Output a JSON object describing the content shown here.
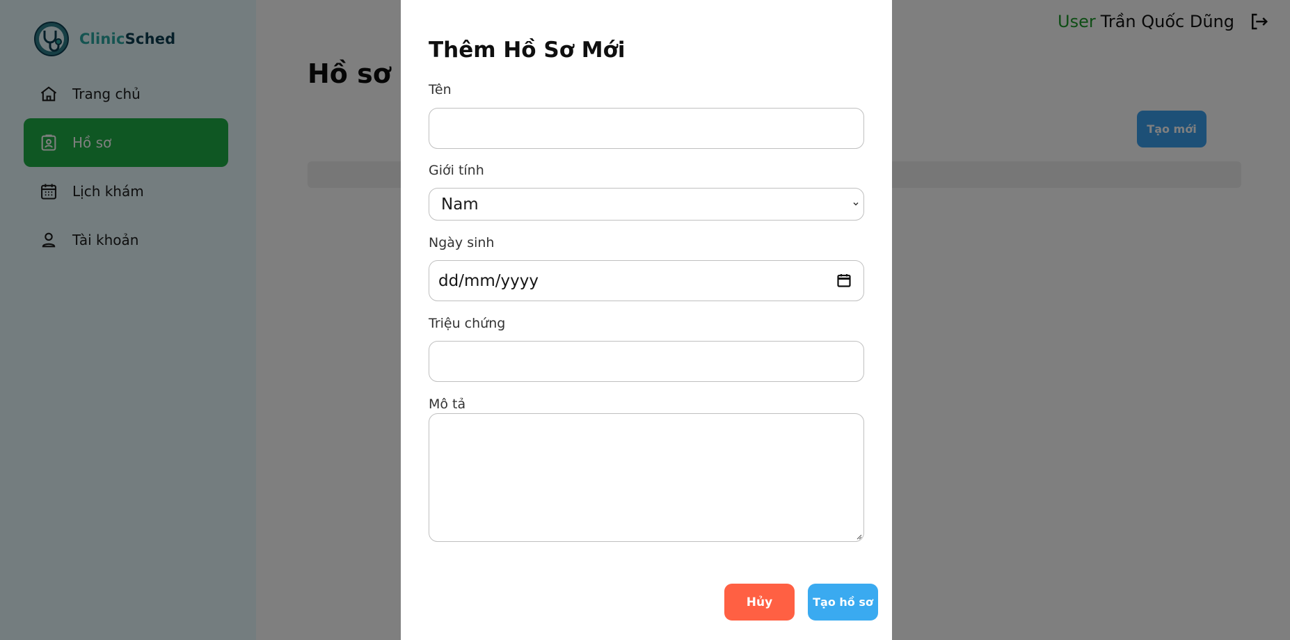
{
  "brand": {
    "name_part1": "Clinic",
    "name_part2": "Sched",
    "logo_icon": "stethoscope-logo-icon"
  },
  "sidebar": {
    "items": [
      {
        "label": "Trang chủ",
        "icon": "home-icon",
        "active": false
      },
      {
        "label": "Hồ sơ",
        "icon": "profile-badge-icon",
        "active": true
      },
      {
        "label": "Lịch khám",
        "icon": "calendar-icon",
        "active": false
      },
      {
        "label": "Tài khoản",
        "icon": "user-icon",
        "active": false
      }
    ]
  },
  "header": {
    "user_prefix": "User",
    "user_name": "Trần Quốc Dũng",
    "logout_icon": "logout-icon"
  },
  "main": {
    "title": "Hồ sơ",
    "create_button": "Tạo mới"
  },
  "modal": {
    "title": "Thêm Hồ Sơ Mới",
    "fields": {
      "name_label": "Tên",
      "name_value": "",
      "gender_label": "Giới tính",
      "gender_value": "Nam",
      "dob_label": "Ngày sinh",
      "dob_value": "dd/mm/yyyy",
      "symptoms_label": "Triệu chứng",
      "symptoms_value": "",
      "description_label": "Mô tả",
      "description_value": ""
    },
    "cancel_button": "Hủy",
    "submit_button": "Tạo hồ sơ"
  },
  "colors": {
    "sidebar_bg": "#e8fbff",
    "active_nav": "#1fae46",
    "brand_teal": "#2aa8a2",
    "brand_dark": "#0c3f52",
    "user_green": "#1d9a2a",
    "primary_blue": "#3aa0ee",
    "cancel_red": "#ff6043",
    "overlay": "rgba(0,0,0,0.5)"
  }
}
